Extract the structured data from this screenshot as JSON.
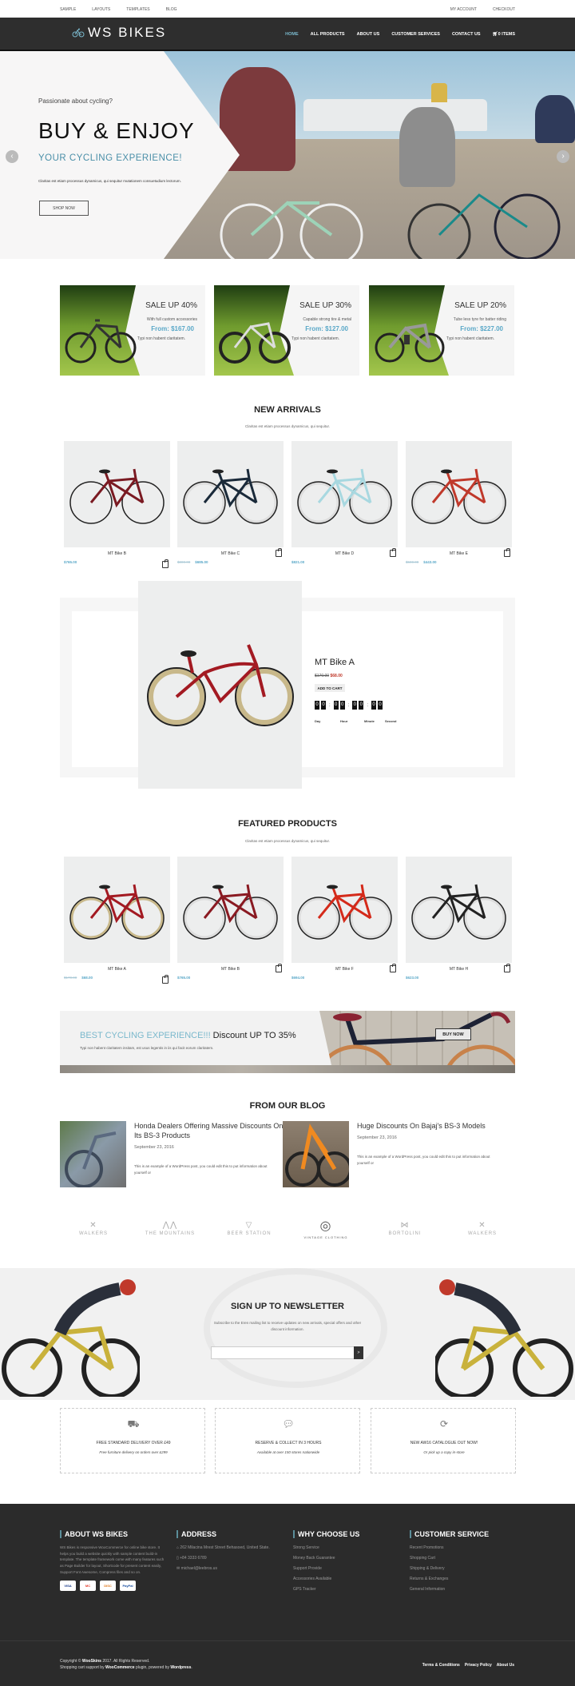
{
  "topbar": {
    "left_links": [
      "SAMPLE",
      "LAYOUTS",
      "TEMPLATES",
      "BLOG"
    ],
    "right_links": [
      "MY ACCOUNT",
      "CHECKOUT"
    ]
  },
  "nav": {
    "logo": "WS BIKES",
    "items": [
      "HOME",
      "ALL PRODUCTS",
      "ABOUT US",
      "CUSTOMER SERVICES",
      "CONTACT US"
    ],
    "cart": "0 ITEMS",
    "accent": "#7ab8cc"
  },
  "hero": {
    "tagline": "Passionate about cycling?",
    "title": "BUY & ENJOY",
    "subtitle": "YOUR CYCLING EXPERIENCE!",
    "description": "Claritas est etiam processus dynamicus, qui sequitur mutationem consuetudium lectorum.",
    "button": "SHOP NOW"
  },
  "sales": [
    {
      "title": "SALE UP 40%",
      "desc": "With full custom accessories",
      "price": "From: $167.00",
      "note": "Typi non habent claritatem."
    },
    {
      "title": "SALE UP 30%",
      "desc": "Capable strong tire & metal",
      "price": "From: $127.00",
      "note": "Typi non habent claritatem."
    },
    {
      "title": "SALE UP 20%",
      "desc": "Tube less tyre for batter riding",
      "price": "From: $227.00",
      "note": "Typi non habent claritatem."
    }
  ],
  "new_arrivals": {
    "title": "NEW ARRIVALS",
    "subtitle": "Claritas est etiam processus dynamicus, qui sequitur.",
    "products": [
      {
        "name": "MT Bike B",
        "old_price": "",
        "price": "$765.00"
      },
      {
        "name": "MT Bike C",
        "old_price": "$800.00",
        "price": "$685.00"
      },
      {
        "name": "MT Bike D",
        "old_price": "",
        "price": "$821.00"
      },
      {
        "name": "MT Bike E",
        "old_price": "$500.00",
        "price": "$443.00"
      }
    ]
  },
  "deal": {
    "name": "MT Bike A",
    "old_price": "$170.00",
    "price": "$68.00",
    "button": "ADD TO CART",
    "countdown": [
      "00",
      "00",
      "00",
      "00"
    ],
    "labels": [
      "Day",
      "Hour",
      "Minute",
      "Second"
    ]
  },
  "featured": {
    "title": "FEATURED PRODUCTS",
    "subtitle": "Claritas est etiam processus dynamicus, qui sequitur.",
    "products": [
      {
        "name": "MT Bike A",
        "old_price": "$170.00",
        "price": "$68.00"
      },
      {
        "name": "MT Bike B",
        "old_price": "",
        "price": "$765.00"
      },
      {
        "name": "MT Bike F",
        "old_price": "",
        "price": "$694.00"
      },
      {
        "name": "MT Bike H",
        "old_price": "",
        "price": "$623.00"
      }
    ]
  },
  "promo": {
    "highlight": "BEST CYCLING EXPERIENCE!!!",
    "text": " Discount UP TO 35%",
    "desc": "Typi non habent claritatem insitam, est usus legentis in iis qui facit eorum claritatem.",
    "button": "BUY NOW"
  },
  "blog": {
    "title": "FROM OUR BLOG",
    "posts": [
      {
        "title": "Honda Dealers Offering Massive Discounts On Its BS-3 Products",
        "date": "September 23, 2016",
        "excerpt": "This is an example of a WordPress post, you could edit this to put information about yourself or"
      },
      {
        "title": "Huge Discounts On Bajaj's BS-3 Models",
        "date": "September 23, 2016",
        "excerpt": "This is an example of a WordPress post, you could edit this to put information about yourself or"
      }
    ]
  },
  "brands": [
    "WALKERS",
    "THE MOUNTAINS",
    "BEER STATION",
    "VINTAGE CLOTHING",
    "BORTOLINI",
    "WALKERS"
  ],
  "newsletter": {
    "title": "SIGN UP TO NEWSLETTER",
    "desc": "Subscribe to the Eren mailing list to receive updates on new arrivals, special offers and other discount information.",
    "placeholder": "",
    "button": ">"
  },
  "features": [
    {
      "icon": "truck-icon",
      "title": "FREE STANDARD DELIVERY OVER £49",
      "sub": "Free furniture delivery on orders over £299"
    },
    {
      "icon": "chat-icon",
      "title": "RESERVE & COLLECT IN 3 HOURS",
      "sub": "Available at over 150 stores nationwide"
    },
    {
      "icon": "refresh-icon",
      "title": "NEW AW16 CATALOGUE OUT NOW!",
      "sub": "Or pick up a copy in-store"
    }
  ],
  "footer": {
    "about_title": "ABOUT WS BIKES",
    "about_text": "WS Bikes is responsive WooCommerce for online bike store. It helps you build a website quickly with sample content build-in template. The template framework come with many features such as Page Builder for layout, Shortcode for present content easily, Support Font Awesome, Compress files and so on.",
    "payment": [
      "VISA",
      "MC",
      "DISC",
      "PayPal"
    ],
    "address_title": "ADDRESS",
    "address": "262 Milacina Mrest Street Behasoed, United State.",
    "phone": "+84 3333 6789",
    "email": "michael@leebros.us",
    "why_title": "WHY CHOOSE US",
    "why_items": [
      "Strong Service",
      "Money Back Guarantee",
      "Support Provide",
      "Accessories Available",
      "GPS Tracker"
    ],
    "cs_title": "CUSTOMER SERVICE",
    "cs_items": [
      "Recent Promotions",
      "Shopping Cart",
      "Shipping & Delivery",
      "Returns & Exchanges",
      "General Information"
    ],
    "copyright_1": "Copyright © ",
    "copyright_brand": "WooSkins",
    "copyright_2": " 2017. All Rights Reserved.",
    "support_1": "Shopping cart support by ",
    "support_brand": "WooCommerce",
    "support_2": " plugin, powered by ",
    "support_wp": "Wordpress",
    "links": [
      "Terms & Conditions",
      "Privacy Policy",
      "About Us"
    ]
  }
}
